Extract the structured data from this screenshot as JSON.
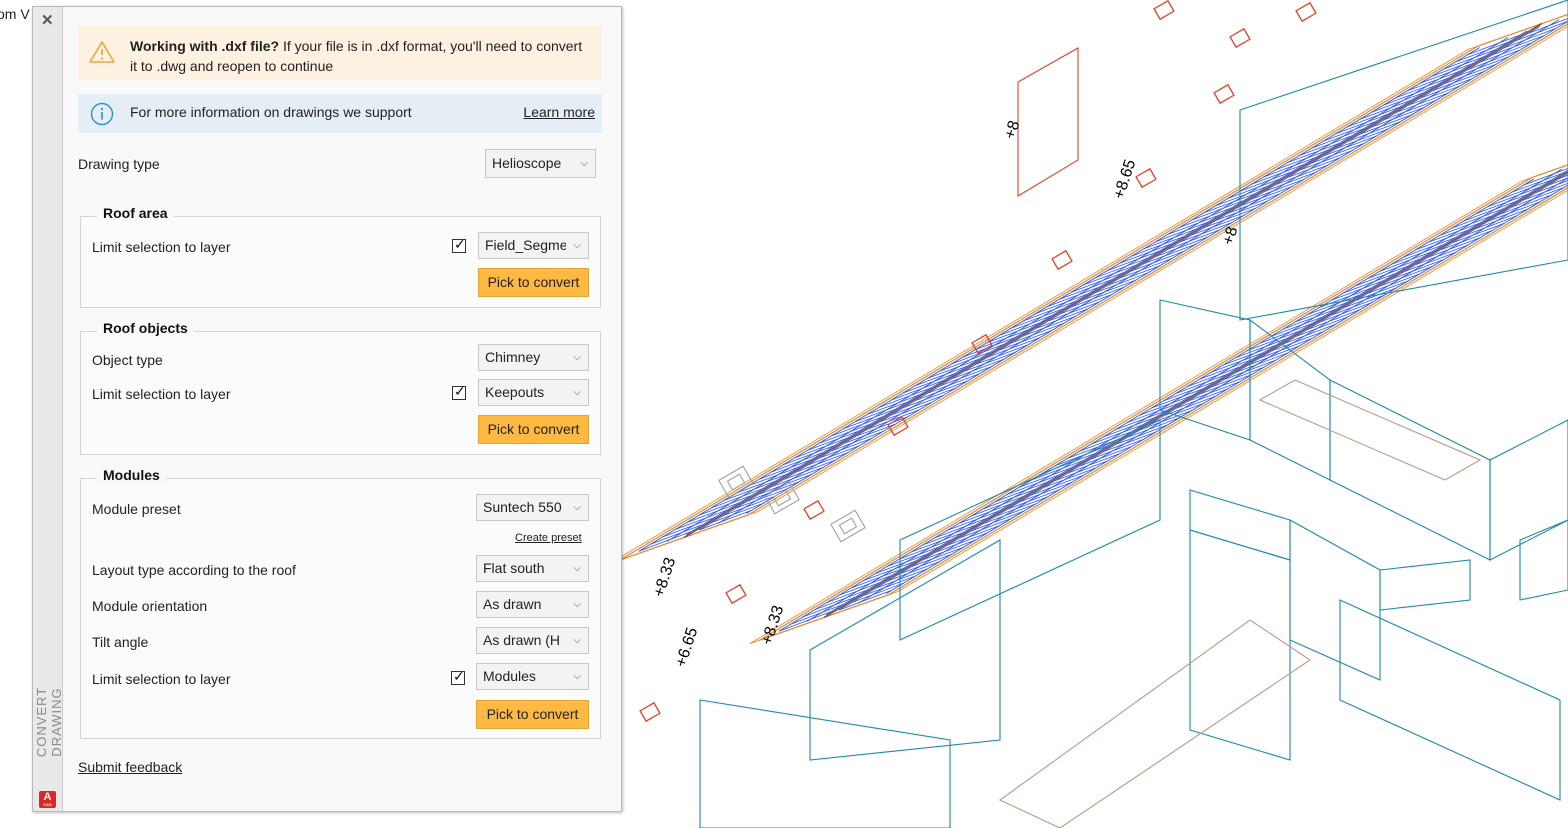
{
  "viewport": {
    "title_fragment": "om V"
  },
  "panel": {
    "vertical_title": "CONVERT DRAWING",
    "close_symbol": "✕",
    "app_icon_letter": "A",
    "app_icon_sub": "CAD",
    "warning": {
      "bold": "Working with .dxf file?",
      "text": " If your file is in .dxf format, you'll need to convert it to .dwg and reopen to continue"
    },
    "info": {
      "text": "For more information on drawings we support",
      "link": "Learn more"
    },
    "drawing_type": {
      "label": "Drawing type",
      "value": "Helioscope"
    },
    "roof_area": {
      "title": "Roof area",
      "limit_label": "Limit selection to layer",
      "limit_checked": true,
      "layer_value": "Field_Segments",
      "pick_button": "Pick to convert"
    },
    "roof_objects": {
      "title": "Roof objects",
      "object_type_label": "Object type",
      "object_type_value": "Chimney",
      "limit_label": "Limit selection to layer",
      "limit_checked": true,
      "layer_value": "Keepouts",
      "pick_button": "Pick to convert"
    },
    "modules": {
      "title": "Modules",
      "preset_label": "Module preset",
      "preset_value": "Suntech 550",
      "create_preset": "Create preset",
      "layout_label": "Layout type according to the roof",
      "layout_value": "Flat south",
      "orientation_label": "Module orientation",
      "orientation_value": "As drawn",
      "tilt_label": "Tilt angle",
      "tilt_value": "As drawn (H",
      "limit_label": "Limit selection to layer",
      "limit_checked": true,
      "layer_value": "Modules",
      "pick_button": "Pick to convert"
    },
    "feedback": "Submit feedback"
  },
  "drawing_labels": [
    "+8",
    "+8.65",
    "+8",
    "+8.33",
    "+6.65",
    "+8.33"
  ],
  "colors": {
    "accent_button": "#fdb941",
    "warning_bg": "#fdf1e1",
    "info_bg": "#e5eef4",
    "cad_orange": "#e8862a",
    "cad_blue": "#2b55e6",
    "cad_teal": "#1d8aa6",
    "cad_red": "#e0442a"
  },
  "icons": [
    "close-icon",
    "warning-icon",
    "info-icon",
    "chevron-down-icon",
    "checkbox-checked-icon",
    "autocad-icon"
  ]
}
